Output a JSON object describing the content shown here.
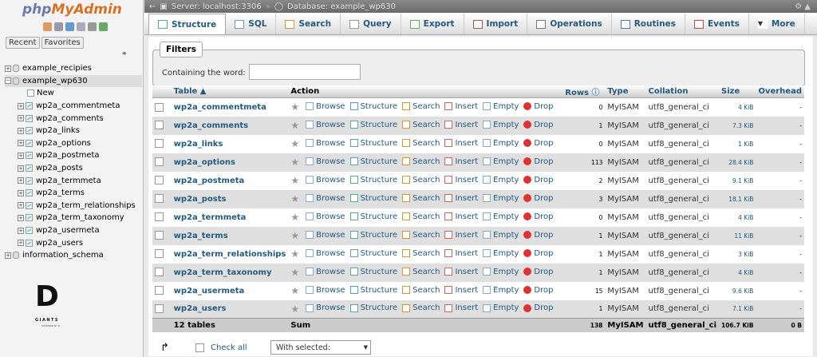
{
  "nav": {
    "logo_php": "php",
    "logo_rest": "MyAdmin",
    "recent_label": "Recent",
    "favorites_label": "Favorites",
    "tree": [
      {
        "label": "example_recipies",
        "level": 0
      },
      {
        "label": "example_wp630",
        "level": 0
      },
      {
        "label": "New",
        "level": 1
      },
      {
        "label": "wp2a_commentmeta",
        "level": 1
      },
      {
        "label": "wp2a_comments",
        "level": 1
      },
      {
        "label": "wp2a_links",
        "level": 1
      },
      {
        "label": "wp2a_options",
        "level": 1
      },
      {
        "label": "wp2a_postmeta",
        "level": 1
      },
      {
        "label": "wp2a_posts",
        "level": 1
      },
      {
        "label": "wp2a_termmeta",
        "level": 1
      },
      {
        "label": "wp2a_terms",
        "level": 1
      },
      {
        "label": "wp2a_term_relationships",
        "level": 1
      },
      {
        "label": "wp2a_term_taxonomy",
        "level": 1
      },
      {
        "label": "wp2a_usermeta",
        "level": 1
      },
      {
        "label": "wp2a_users",
        "level": 1
      },
      {
        "label": "information_schema",
        "level": 0
      }
    ],
    "brand": {
      "letter": "D",
      "name": "GIANTS",
      "tag": "POWERED BY D"
    }
  },
  "breadcrumb": {
    "server": "Server: localhost:3306",
    "database": "Database: example_wp630"
  },
  "tabs": [
    {
      "label": "Structure",
      "icon": "structure-icon",
      "color": "#5a9"
    },
    {
      "label": "SQL",
      "icon": "sql-icon",
      "color": "#79b"
    },
    {
      "label": "Search",
      "icon": "search-icon",
      "color": "#c93"
    },
    {
      "label": "Query",
      "icon": "query-icon",
      "color": "#999"
    },
    {
      "label": "Export",
      "icon": "export-icon",
      "color": "#6a6"
    },
    {
      "label": "Import",
      "icon": "import-icon",
      "color": "#a55"
    },
    {
      "label": "Operations",
      "icon": "wrench-icon",
      "color": "#777"
    },
    {
      "label": "Routines",
      "icon": "routines-icon",
      "color": "#57a"
    },
    {
      "label": "Events",
      "icon": "clock-icon",
      "color": "#c44"
    },
    {
      "label": "More",
      "icon": "chevron-down-icon",
      "color": "#333"
    }
  ],
  "filters": {
    "legend": "Filters",
    "label": "Containing the word:",
    "value": ""
  },
  "columns": {
    "table": "Table",
    "action": "Action",
    "rows": "Rows",
    "type": "Type",
    "collation": "Collation",
    "size": "Size",
    "overhead": "Overhead"
  },
  "actions": [
    "Browse",
    "Structure",
    "Search",
    "Insert",
    "Empty",
    "Drop"
  ],
  "tables": [
    {
      "name": "wp2a_commentmeta",
      "rows": "0",
      "type": "MyISAM",
      "collation": "utf8_general_ci",
      "size": "4 KiB",
      "overhead": "-"
    },
    {
      "name": "wp2a_comments",
      "rows": "1",
      "type": "MyISAM",
      "collation": "utf8_general_ci",
      "size": "7.3 KiB",
      "overhead": "-"
    },
    {
      "name": "wp2a_links",
      "rows": "0",
      "type": "MyISAM",
      "collation": "utf8_general_ci",
      "size": "1 KiB",
      "overhead": "-"
    },
    {
      "name": "wp2a_options",
      "rows": "113",
      "type": "MyISAM",
      "collation": "utf8_general_ci",
      "size": "28.4 KiB",
      "overhead": "-"
    },
    {
      "name": "wp2a_postmeta",
      "rows": "2",
      "type": "MyISAM",
      "collation": "utf8_general_ci",
      "size": "9.1 KiB",
      "overhead": "-"
    },
    {
      "name": "wp2a_posts",
      "rows": "3",
      "type": "MyISAM",
      "collation": "utf8_general_ci",
      "size": "18.1 KiB",
      "overhead": "-"
    },
    {
      "name": "wp2a_termmeta",
      "rows": "0",
      "type": "MyISAM",
      "collation": "utf8_general_ci",
      "size": "4 KiB",
      "overhead": "-"
    },
    {
      "name": "wp2a_terms",
      "rows": "1",
      "type": "MyISAM",
      "collation": "utf8_general_ci",
      "size": "11 KiB",
      "overhead": "-"
    },
    {
      "name": "wp2a_term_relationships",
      "rows": "1",
      "type": "MyISAM",
      "collation": "utf8_general_ci",
      "size": "3 KiB",
      "overhead": "-"
    },
    {
      "name": "wp2a_term_taxonomy",
      "rows": "1",
      "type": "MyISAM",
      "collation": "utf8_general_ci",
      "size": "4 KiB",
      "overhead": "-"
    },
    {
      "name": "wp2a_usermeta",
      "rows": "15",
      "type": "MyISAM",
      "collation": "utf8_general_ci",
      "size": "9.6 KiB",
      "overhead": "-"
    },
    {
      "name": "wp2a_users",
      "rows": "1",
      "type": "MyISAM",
      "collation": "utf8_general_ci",
      "size": "7.1 KiB",
      "overhead": "-"
    }
  ],
  "summary": {
    "tables": "12 tables",
    "action": "Sum",
    "rows": "138",
    "type": "MyISAM",
    "collation": "utf8_general_ci",
    "size": "106.7 KiB",
    "overhead": "0 B"
  },
  "footer": {
    "check_all": "Check all",
    "with_selected": "With selected:"
  },
  "colors": {
    "link": "#235a81",
    "logo_orange": "#d87020",
    "logo_blue": "#6c78af"
  }
}
